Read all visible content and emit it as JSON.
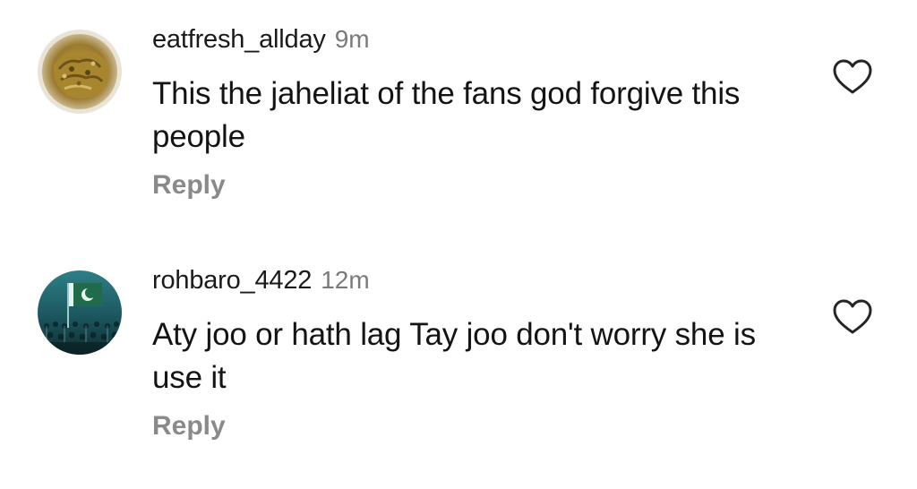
{
  "comments": [
    {
      "username": "eatfresh_allday",
      "time": "9m",
      "text": "This the jaheliat of the fans god forgive this people",
      "reply_label": "Reply",
      "avatar_icon": "food-photo-avatar",
      "like_icon": "heart-outline-icon"
    },
    {
      "username": "rohbaro_4422",
      "time": "12m",
      "text": "Aty joo or hath lag Tay joo don't worry she is use it",
      "reply_label": "Reply",
      "avatar_icon": "pakistan-flag-crowd-avatar",
      "like_icon": "heart-outline-icon"
    }
  ],
  "colors": {
    "text": "#141414",
    "muted": "#7a7a7a",
    "reply": "#8a8a8a",
    "icon": "#262626"
  }
}
